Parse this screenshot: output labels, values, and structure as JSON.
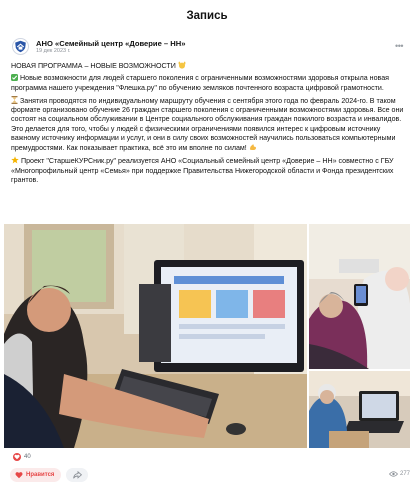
{
  "header": {
    "title": "Запись"
  },
  "post": {
    "author": "АНО «Семейный центр «Доверие – НН»",
    "date": "19 дек 2023 г.",
    "heading": "НОВАЯ ПРОГРАММА – НОВЫЕ ВОЗМОЖНОСТИ",
    "p1": "Новые возможности для людей старшего поколения с ограниченными возможностями здоровья открыла новая программа нашего учреждения \"Флешка.ру\" по обучению земляков почтенного возраста цифровой грамотности.",
    "p2": "Занятия проводятся по индивидуальному маршруту обучения с сентября этого года по февраль 2024-го. В таком формате организовано обучение 26 граждан старшего поколения с ограниченными возможностями здоровья. Все они состоят на социальном обслуживании в Центре социального обслуживания граждан пожилого возраста и инвалидов. Это делается для того, чтобы у людей с физическими ограничениями появился интерес к цифровым источнику важному источнику информации и услуг, и они в силу своих возможностей научились пользоваться компьютерными премудростями. Как показывает практика, всё это им вполне по силам!",
    "p3": "Проект \"СтаршеКУРСник.ру\" реализуется АНО «Социальный семейный центр «Доверие – НН» совместно с ГБУ «Многопрофильный центр «Семья» при поддержке Правительства Нижегородской области и Фонда президентских грантов."
  },
  "footer": {
    "likes": "40",
    "like_label": "Нравится",
    "views": "277"
  },
  "icons": [
    "logo-icon",
    "more-icon",
    "heart-icon",
    "share-icon",
    "eye-icon"
  ],
  "colors": {
    "like": "#e64646",
    "like_bg": "#fbeaea",
    "check": "#4caf50",
    "hourglass": "#c28a1e",
    "star": "#f5b400"
  }
}
